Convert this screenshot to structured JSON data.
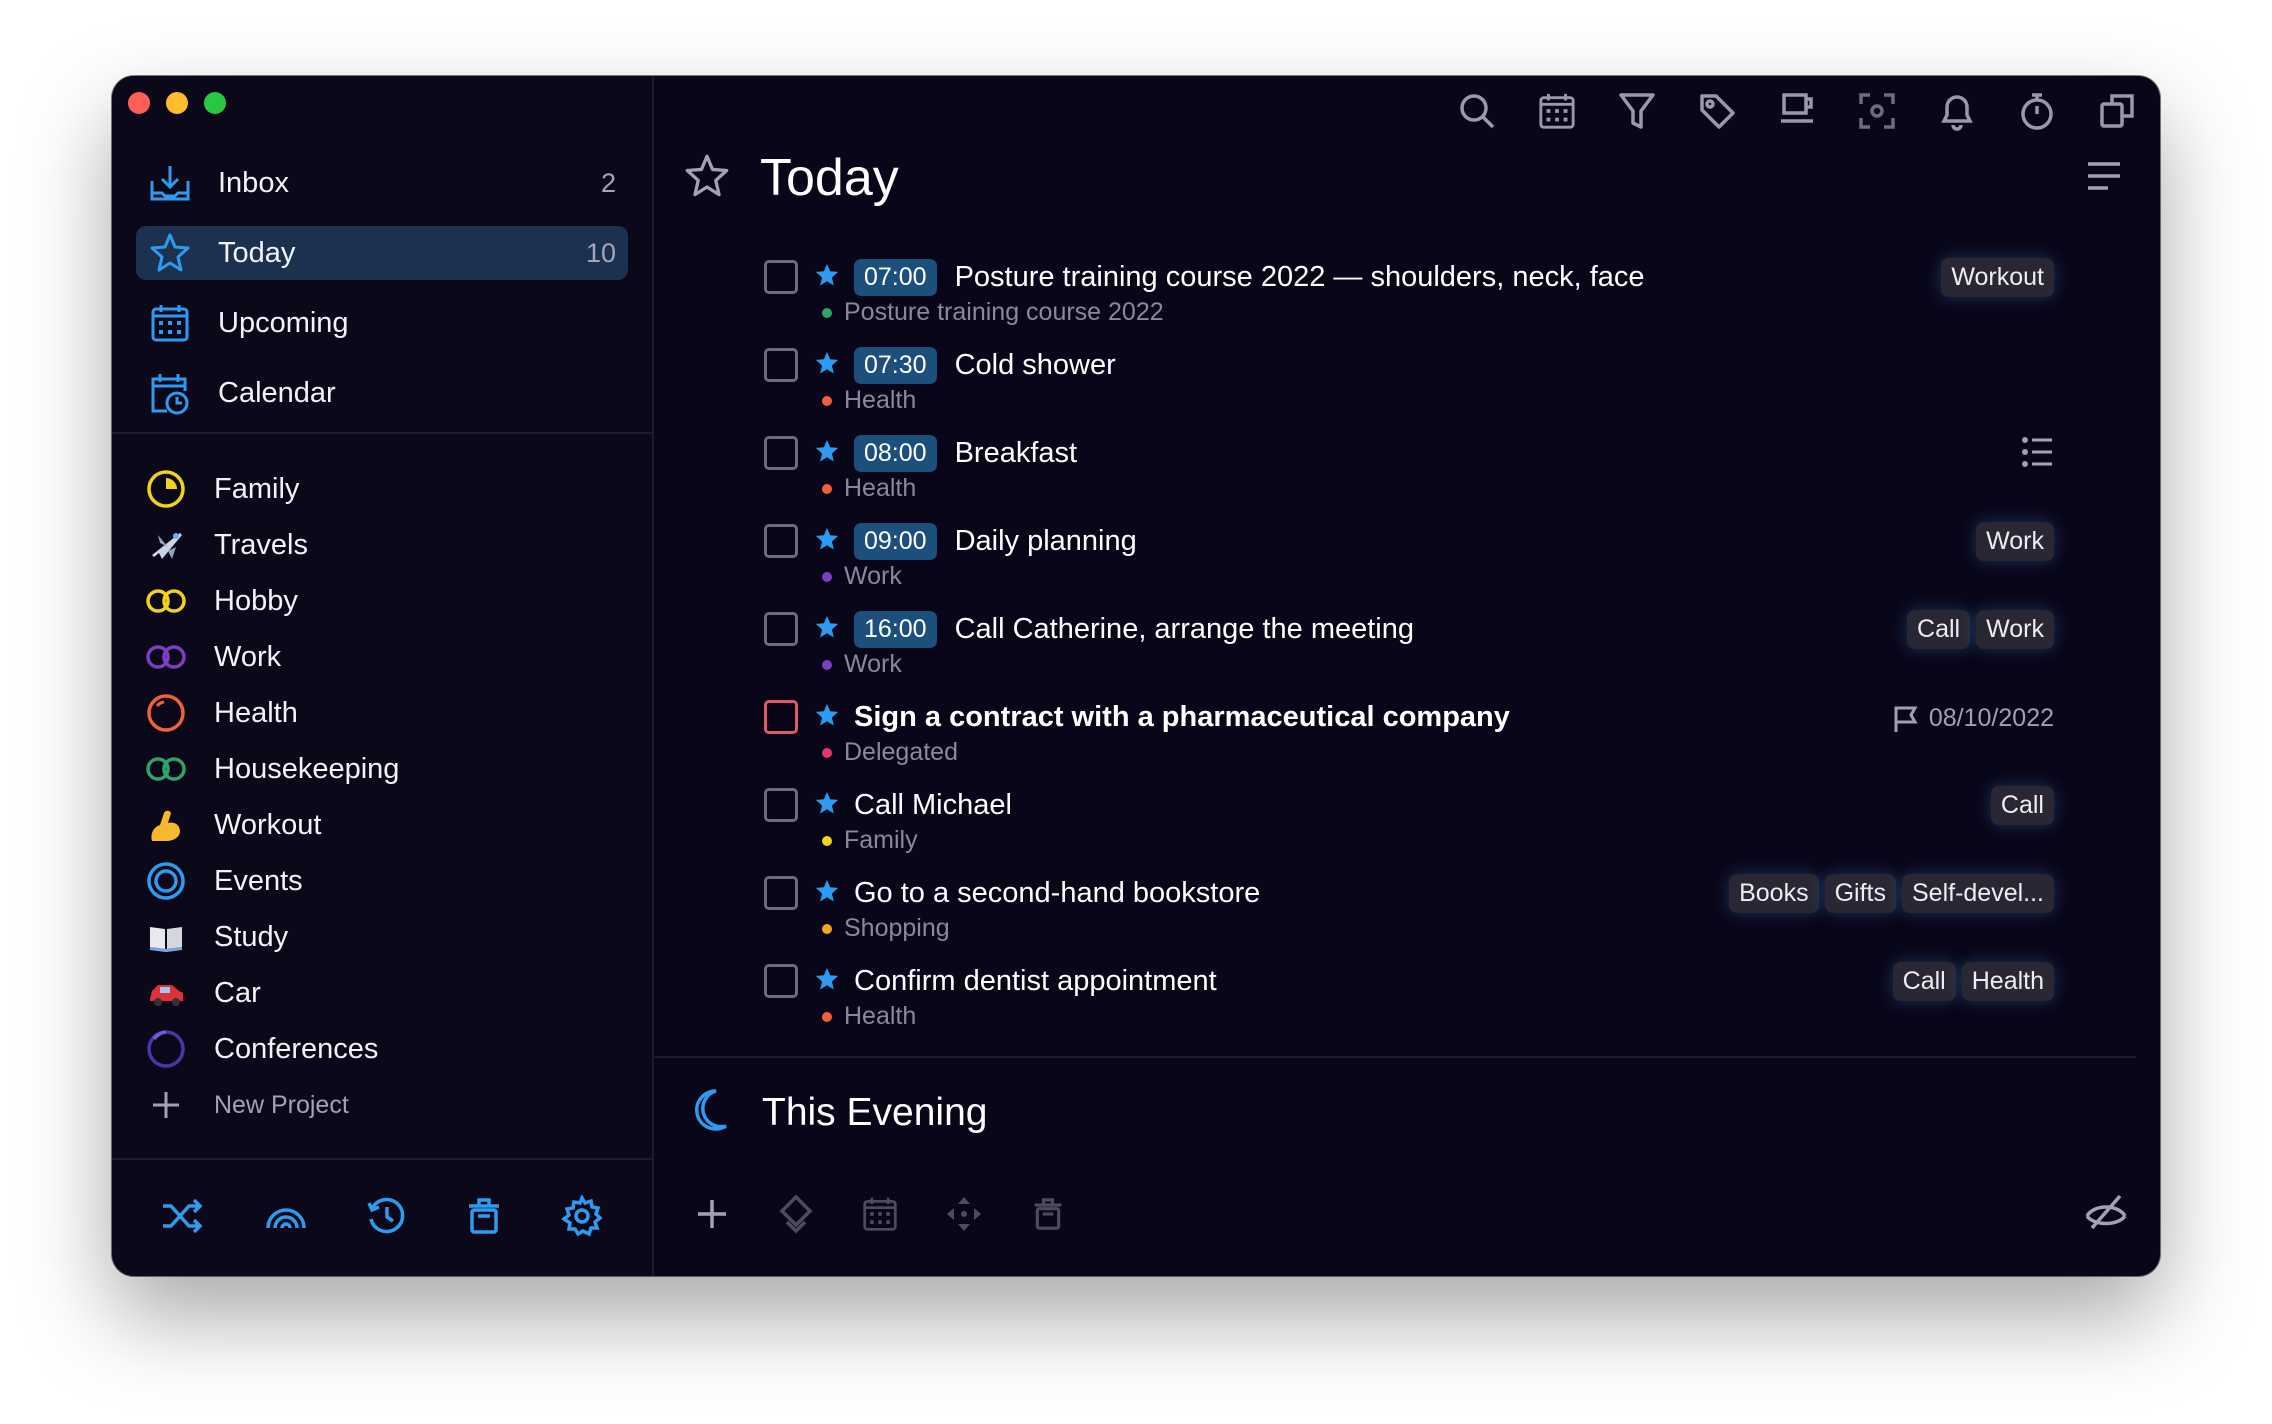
{
  "sidebar": {
    "nav": [
      {
        "label": "Inbox",
        "count": "2",
        "icon": "inbox-icon"
      },
      {
        "label": "Today",
        "count": "10",
        "icon": "star-icon"
      },
      {
        "label": "Upcoming",
        "count": "",
        "icon": "calendar-grid-icon"
      },
      {
        "label": "Calendar",
        "count": "",
        "icon": "calendar-clock-icon"
      }
    ],
    "projects": [
      {
        "label": "Family",
        "icon": "ring-yellow-icon"
      },
      {
        "label": "Travels",
        "icon": "airplane-icon"
      },
      {
        "label": "Hobby",
        "icon": "double-ring-yellow-icon"
      },
      {
        "label": "Work",
        "icon": "double-ring-purple-icon"
      },
      {
        "label": "Health",
        "icon": "ring-orange-icon"
      },
      {
        "label": "Housekeeping",
        "icon": "double-ring-green-icon"
      },
      {
        "label": "Workout",
        "icon": "flexed-biceps-icon"
      },
      {
        "label": "Events",
        "icon": "ring-blue-icon"
      },
      {
        "label": "Study",
        "icon": "open-book-icon"
      },
      {
        "label": "Car",
        "icon": "car-icon"
      },
      {
        "label": "Conferences",
        "icon": "ring-indigo-icon"
      }
    ],
    "new_project": "New Project",
    "footer_icons": [
      "shuffle-icon",
      "rainbow-icon",
      "history-icon",
      "trash-icon",
      "gear-icon"
    ]
  },
  "main": {
    "title": "Today",
    "toolbar_icons": [
      "search-icon",
      "calendar-icon",
      "filter-icon",
      "tag-icon",
      "cup-icon",
      "focus-icon",
      "bell-icon",
      "stopwatch-icon",
      "copy-icon"
    ],
    "tasks": [
      {
        "time": "07:00",
        "name": "Posture training course 2022 — shoulders, neck, face",
        "project": "Posture training course 2022",
        "dot": "#2fa36b",
        "tags": [
          "Workout"
        ],
        "deadline": "",
        "bold": false
      },
      {
        "time": "07:30",
        "name": "Cold shower",
        "project": "Health",
        "dot": "#f0603a",
        "tags": [],
        "deadline": "",
        "bold": false
      },
      {
        "time": "08:00",
        "name": "Breakfast",
        "project": "Health",
        "dot": "#f0603a",
        "tags": [],
        "deadline": "",
        "bold": false,
        "has_notes": true
      },
      {
        "time": "09:00",
        "name": "Daily planning",
        "project": "Work",
        "dot": "#7b3fc4",
        "tags": [
          "Work"
        ],
        "deadline": "",
        "bold": false
      },
      {
        "time": "16:00",
        "name": "Call Catherine, arrange the meeting",
        "project": "Work",
        "dot": "#7b3fc4",
        "tags": [
          "Call",
          "Work"
        ],
        "deadline": "",
        "bold": false
      },
      {
        "time": "",
        "name": "Sign a contract with a pharmaceutical company",
        "project": "Delegated",
        "dot": "#e8356a",
        "tags": [],
        "deadline": "08/10/2022",
        "bold": true
      },
      {
        "time": "",
        "name": "Call Michael",
        "project": "Family",
        "dot": "#f2d21b",
        "tags": [
          "Call"
        ],
        "deadline": "",
        "bold": false
      },
      {
        "time": "",
        "name": "Go to a second-hand bookstore",
        "project": "Shopping",
        "dot": "#f5a623",
        "tags": [
          "Books",
          "Gifts",
          "Self-devel..."
        ],
        "deadline": "",
        "bold": false
      },
      {
        "time": "",
        "name": "Confirm dentist appointment",
        "project": "Health",
        "dot": "#f0603a",
        "tags": [
          "Call",
          "Health"
        ],
        "deadline": "",
        "bold": false
      }
    ],
    "evening_title": "This Evening",
    "footer_icons": [
      "plus-icon",
      "diamond-arrows-icon",
      "calendar-icon",
      "move-icon",
      "trash-icon"
    ],
    "hide_icon": "eye-slash-icon"
  },
  "colors": {
    "accent": "#2d9cf0",
    "background": "#09061a",
    "active_row": "#1c3050",
    "time_chip": "#1d4f7c"
  }
}
